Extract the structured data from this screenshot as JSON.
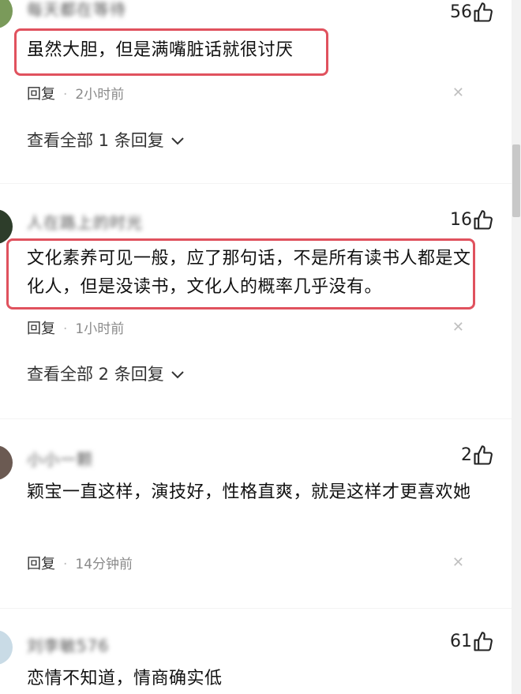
{
  "comments": [
    {
      "username": "每天都在等待",
      "likes": "56",
      "text": "虽然大胆，但是满嘴脏话就很讨厌",
      "reply_label": "回复",
      "time": "2小时前",
      "view_replies": "查看全部 1 条回复"
    },
    {
      "username": "人在路上的时光",
      "likes": "16",
      "text": "文化素养可见一般，应了那句话，不是所有读书人都是文化人，但是没读书，文化人的概率几乎没有。",
      "reply_label": "回复",
      "time": "1小时前",
      "view_replies": "查看全部 2 条回复"
    },
    {
      "username": "小小一颗",
      "likes": "2",
      "text": "颖宝一直这样，演技好，性格直爽，就是这样才更喜欢她",
      "reply_label": "回复",
      "time": "14分钟前"
    },
    {
      "username": "刘李敏576",
      "likes": "61",
      "text": "恋情不知道，情商确实低"
    }
  ],
  "colors": {
    "highlight": "#e0525e",
    "meta": "#8a8a8a"
  }
}
